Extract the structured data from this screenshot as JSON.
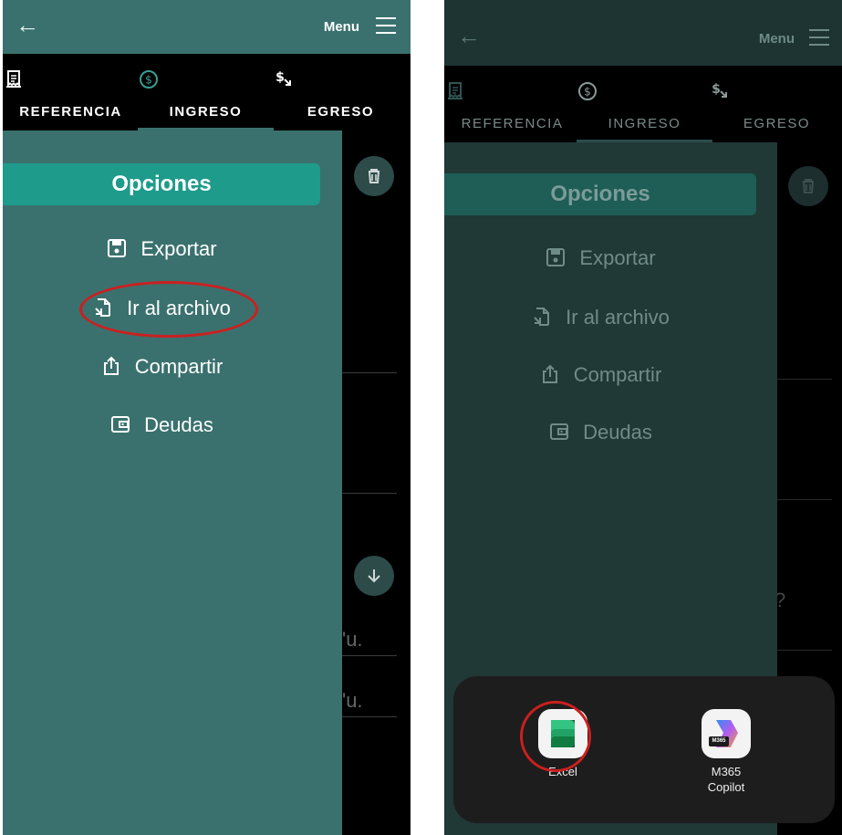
{
  "left": {
    "menu_label": "Menu",
    "tabs": [
      {
        "label": "REFERENCIA",
        "icon": "receipt-icon"
      },
      {
        "label": "INGRESO",
        "icon": "dollar-circle-icon",
        "active": true
      },
      {
        "label": "EGRESO",
        "icon": "dollar-down-icon"
      }
    ],
    "drawer": {
      "title": "Opciones",
      "items": [
        {
          "label": "Exportar",
          "icon": "save-icon"
        },
        {
          "label": "Ir al archivo",
          "icon": "open-file-icon",
          "highlighted": true
        },
        {
          "label": "Compartir",
          "icon": "share-icon"
        },
        {
          "label": "Deudas",
          "icon": "wallet-icon"
        }
      ]
    },
    "background": {
      "partial_text_1": "'u.",
      "partial_text_2": "'u."
    }
  },
  "right": {
    "menu_label": "Menu",
    "tabs": [
      {
        "label": "REFERENCIA",
        "icon": "receipt-icon"
      },
      {
        "label": "INGRESO",
        "icon": "dollar-circle-icon",
        "active": true
      },
      {
        "label": "EGRESO",
        "icon": "dollar-down-icon"
      }
    ],
    "drawer": {
      "title": "Opciones",
      "items": [
        {
          "label": "Exportar",
          "icon": "save-icon"
        },
        {
          "label": "Ir al archivo",
          "icon": "open-file-icon"
        },
        {
          "label": "Compartir",
          "icon": "share-icon"
        },
        {
          "label": "Deudas",
          "icon": "wallet-icon"
        }
      ]
    },
    "background": {
      "partial_text": "?"
    },
    "app_chooser": {
      "apps": [
        {
          "label": "Excel",
          "icon": "excel-icon",
          "highlighted": true
        },
        {
          "label_line1": "M365",
          "label_line2": "Copilot",
          "icon": "m365-copilot-icon",
          "badge": "M365"
        }
      ]
    }
  },
  "colors": {
    "teal_bar": "#3a716e",
    "teal_button": "#1e9b8b",
    "dimmed_bar": "#1e3433",
    "highlight_red": "#cc1f1f"
  }
}
